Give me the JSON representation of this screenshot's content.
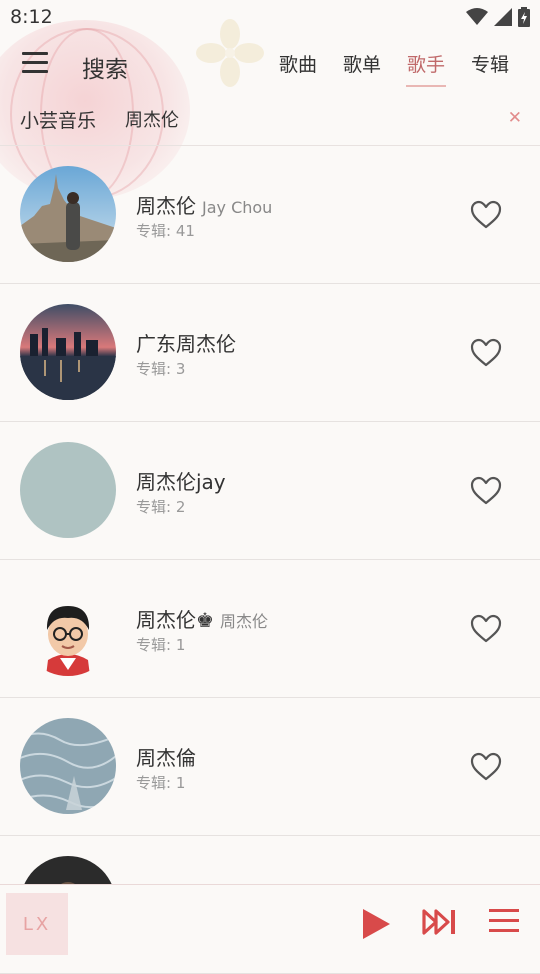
{
  "status": {
    "time": "8:12"
  },
  "header": {
    "title": "搜索",
    "tabs": [
      {
        "label": "歌曲",
        "active": false
      },
      {
        "label": "歌单",
        "active": false
      },
      {
        "label": "歌手",
        "active": true
      },
      {
        "label": "专辑",
        "active": false
      }
    ]
  },
  "sources": {
    "items": [
      "小芸音乐",
      "周杰伦"
    ],
    "clear_icon": "close-icon"
  },
  "artists": [
    {
      "name": "周杰伦",
      "alias": "Jay Chou",
      "albums": "专辑: 41",
      "avatar": "castle-photo"
    },
    {
      "name": "广东周杰伦",
      "alias": "",
      "albums": "专辑: 3",
      "avatar": "city-night-photo"
    },
    {
      "name": "周杰伦jay",
      "alias": "",
      "albums": "专辑: 2",
      "avatar": "plain-gray"
    },
    {
      "name": "周杰伦♚",
      "alias": "周杰伦",
      "albums": "专辑: 1",
      "avatar": "cartoon-avatar"
    },
    {
      "name": "周杰倫",
      "alias": "",
      "albums": "专辑: 1",
      "avatar": "water-photo"
    }
  ],
  "player": {
    "logo": "LX"
  },
  "colors": {
    "accent": "#c0696a",
    "player_icon": "#d84a4a",
    "background": "#fbf9f7"
  }
}
